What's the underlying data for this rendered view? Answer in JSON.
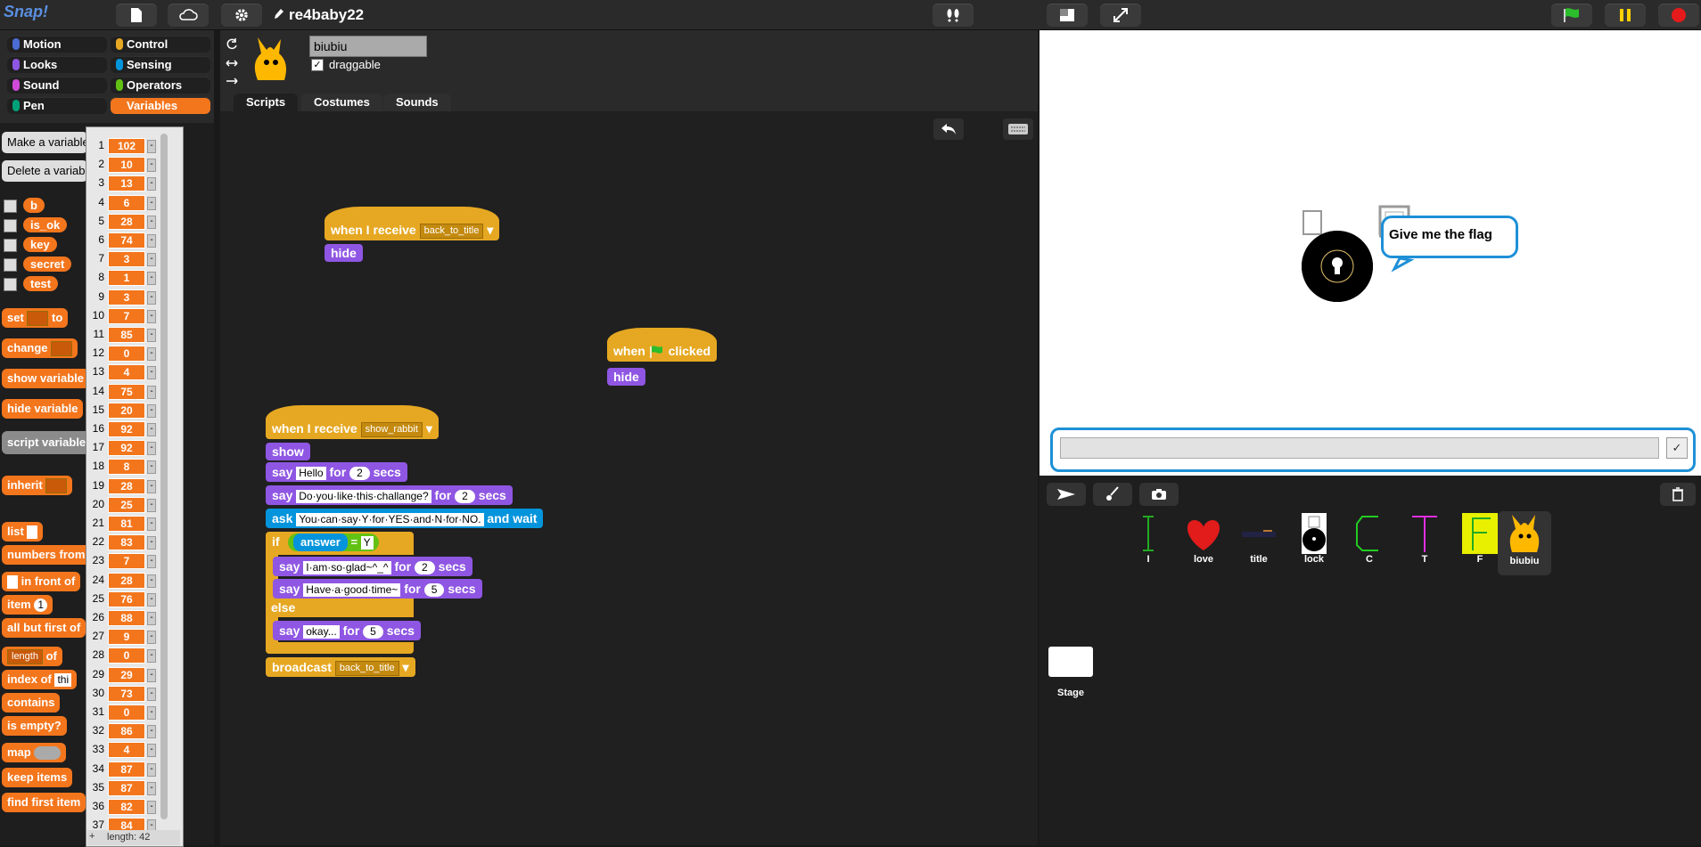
{
  "app": {
    "logo": "Snap!",
    "project_title": "re4baby22"
  },
  "categories": [
    {
      "label": "Motion",
      "color": "#4a6cd4"
    },
    {
      "label": "Looks",
      "color": "#8f56e3"
    },
    {
      "label": "Sound",
      "color": "#cf4ad9"
    },
    {
      "label": "Pen",
      "color": "#00a178"
    },
    {
      "label": "Control",
      "color": "#e6a822"
    },
    {
      "label": "Sensing",
      "color": "#0494dc"
    },
    {
      "label": "Operators",
      "color": "#62c213"
    },
    {
      "label": "Variables",
      "color": "#f3761d"
    }
  ],
  "palette": {
    "make_var": "Make a variable",
    "delete_var": "Delete a variable",
    "vars": [
      "b",
      "is_ok",
      "key",
      "secret",
      "test"
    ],
    "blocks": [
      "set",
      "to",
      "change",
      "show variable",
      "hide variable",
      "script variables",
      "inherit",
      "list",
      "numbers from",
      "in front of",
      "item",
      "all but first of",
      "length",
      "of",
      "index of",
      "contains",
      "is",
      "empty?",
      "map",
      "keep items",
      "find first item"
    ],
    "item_value": "1",
    "length_option": "length",
    "index_input": "thi"
  },
  "list_watcher": {
    "items": [
      {
        "i": "1",
        "v": "102"
      },
      {
        "i": "2",
        "v": "10"
      },
      {
        "i": "3",
        "v": "13"
      },
      {
        "i": "4",
        "v": "6"
      },
      {
        "i": "5",
        "v": "28"
      },
      {
        "i": "6",
        "v": "74"
      },
      {
        "i": "7",
        "v": "3"
      },
      {
        "i": "8",
        "v": "1"
      },
      {
        "i": "9",
        "v": "3"
      },
      {
        "i": "10",
        "v": "7"
      },
      {
        "i": "11",
        "v": "85"
      },
      {
        "i": "12",
        "v": "0"
      },
      {
        "i": "13",
        "v": "4"
      },
      {
        "i": "14",
        "v": "75"
      },
      {
        "i": "15",
        "v": "20"
      },
      {
        "i": "16",
        "v": "92"
      },
      {
        "i": "17",
        "v": "92"
      },
      {
        "i": "18",
        "v": "8"
      },
      {
        "i": "19",
        "v": "28"
      },
      {
        "i": "20",
        "v": "25"
      },
      {
        "i": "21",
        "v": "81"
      },
      {
        "i": "22",
        "v": "83"
      },
      {
        "i": "23",
        "v": "7"
      },
      {
        "i": "24",
        "v": "28"
      },
      {
        "i": "25",
        "v": "76"
      },
      {
        "i": "26",
        "v": "88"
      },
      {
        "i": "27",
        "v": "9"
      },
      {
        "i": "28",
        "v": "0"
      },
      {
        "i": "29",
        "v": "29"
      },
      {
        "i": "30",
        "v": "73"
      },
      {
        "i": "31",
        "v": "0"
      },
      {
        "i": "32",
        "v": "86"
      },
      {
        "i": "33",
        "v": "4"
      },
      {
        "i": "34",
        "v": "87"
      },
      {
        "i": "35",
        "v": "87"
      },
      {
        "i": "36",
        "v": "82"
      },
      {
        "i": "37",
        "v": "84"
      }
    ],
    "length_label": "length: 42",
    "minus": "-"
  },
  "sprite": {
    "name": "biubiu",
    "draggable_label": "draggable"
  },
  "tabs": [
    "Scripts",
    "Costumes",
    "Sounds"
  ],
  "scripts": {
    "s1": {
      "hat": "when I receive",
      "msg": "back_to_title",
      "b1": "hide"
    },
    "s2": {
      "hat_a": "when",
      "hat_b": "clicked",
      "b1": "hide"
    },
    "s3": {
      "hat": "when I receive",
      "msg": "show_rabbit",
      "show": "show",
      "say": "say",
      "for": "for",
      "secs": "secs",
      "say1": "Hello",
      "say1_n": "2",
      "say2": "Do·you·like·this·challange?",
      "say2_n": "2",
      "ask": "ask",
      "ask_text": "You·can·say·Y·for·YES·and·N·for·NO.",
      "and_wait": "and wait",
      "if": "if",
      "answer": "answer",
      "eq": "=",
      "y": "Y",
      "say3": "I·am·so·glad~^_^",
      "say3_n": "2",
      "say4": "Have·a·good·time~",
      "say4_n": "5",
      "else": "else",
      "say5": "okay...",
      "say5_n": "5",
      "broadcast": "broadcast",
      "bmsg": "back_to_title"
    }
  },
  "stage": {
    "speech": "Give me the flag"
  },
  "corral": {
    "sprites": [
      "I",
      "love",
      "title",
      "lock",
      "C",
      "T",
      "F",
      "biubiu"
    ],
    "stage_label": "Stage"
  }
}
